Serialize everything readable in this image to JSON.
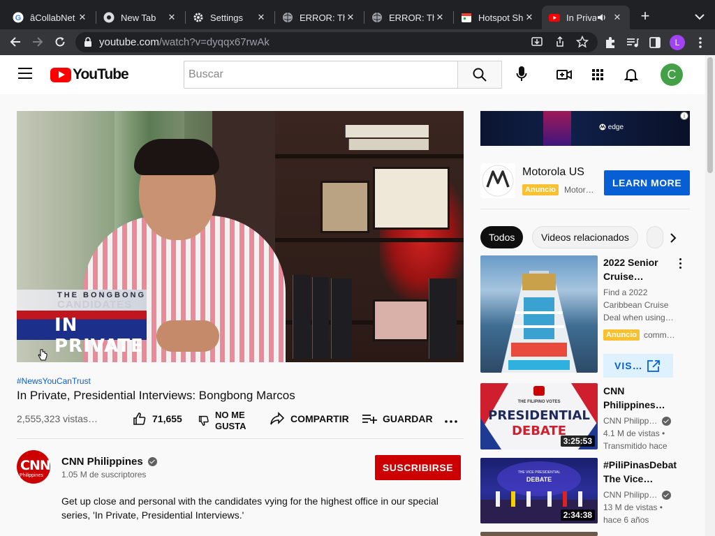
{
  "browser": {
    "tabs": [
      {
        "label": "âCollabNet",
        "icon": "google-icon"
      },
      {
        "label": "New Tab",
        "icon": "chrome-icon"
      },
      {
        "label": "Settings",
        "icon": "gear-icon"
      },
      {
        "label": "ERROR: Th",
        "icon": "globe-icon"
      },
      {
        "label": "ERROR: Th",
        "icon": "globe-icon"
      },
      {
        "label": "Hotspot Sh",
        "icon": "calendar-icon"
      },
      {
        "label": "In Priva",
        "icon": "youtube-icon",
        "active": true
      }
    ],
    "url_host": "youtube.com",
    "url_path": "/watch?v=dyqqx67rwAk",
    "profile_initial": "L"
  },
  "header": {
    "logo_text": "YouTube",
    "search_placeholder": "Buscar",
    "avatar_initial": "C"
  },
  "video": {
    "hashtag": "#NewsYouCanTrust",
    "title": "In Private, Presidential Interviews: Bongbong Marcos",
    "views": "2,555,323 vistas…",
    "likes": "71,655",
    "dislike_label_1": "NO ME",
    "dislike_label_2": "GUSTA",
    "share_label": "COMPARTIR",
    "save_label": "GUARDAR",
    "overlay_line1": "THE BONGBONG",
    "overlay_line2": "CANDIDATES",
    "overlay_line3": "IN PRIVATE"
  },
  "channel": {
    "name": "CNN Philippines",
    "logo_text": "CNN",
    "logo_sub": "Philippines",
    "subscribers": "1.05 M de suscriptores",
    "subscribe_label": "SUSCRIBIRSE",
    "description": "Get up close and personal with the candidates vying for the highest office in our special series, 'In Private, Presidential Interviews.'"
  },
  "ad": {
    "banner_text": "edge",
    "advertiser": "Motorola US",
    "badge": "Anuncio",
    "badge_sub": "Motor…",
    "cta": "LEARN MORE"
  },
  "chips": [
    {
      "label": "Todos",
      "selected": true
    },
    {
      "label": "Videos relacionados",
      "selected": false
    }
  ],
  "related": [
    {
      "title_1": "2022 Senior",
      "title_2": "Cruise…",
      "desc_1": "Find a 2022",
      "desc_2": "Caribbean Cruise",
      "desc_3": "Deal when using…",
      "badge": "Anuncio",
      "badge_sub": "comm…",
      "cta": "VIS…"
    },
    {
      "title_1": "CNN",
      "title_2": "Philippines…",
      "channel": "CNN Philipp…",
      "meta_1": "4.1 M de vistas •",
      "meta_2": "Transmitido hace",
      "duration": "3:25:53",
      "thumb_text_1": "THE FILIPINO VOTES",
      "thumb_text_2": "PRESIDENTIAL",
      "thumb_text_3": "DEBATE"
    },
    {
      "title_1": "#PiliPinasDebat",
      "title_2": "The Vice…",
      "channel": "CNN Philipp…",
      "meta_1": "13 M de vistas •",
      "meta_2": "hace 6 años",
      "duration": "2:34:38",
      "thumb_text_1": "THE VICE PRESIDENTIAL",
      "thumb_text_2": "DEBATE"
    }
  ],
  "colors": {
    "brand_red": "#ff0000",
    "subscribe_red": "#cc0000",
    "link_blue": "#065fd4",
    "ad_yellow": "#fbc02d"
  }
}
